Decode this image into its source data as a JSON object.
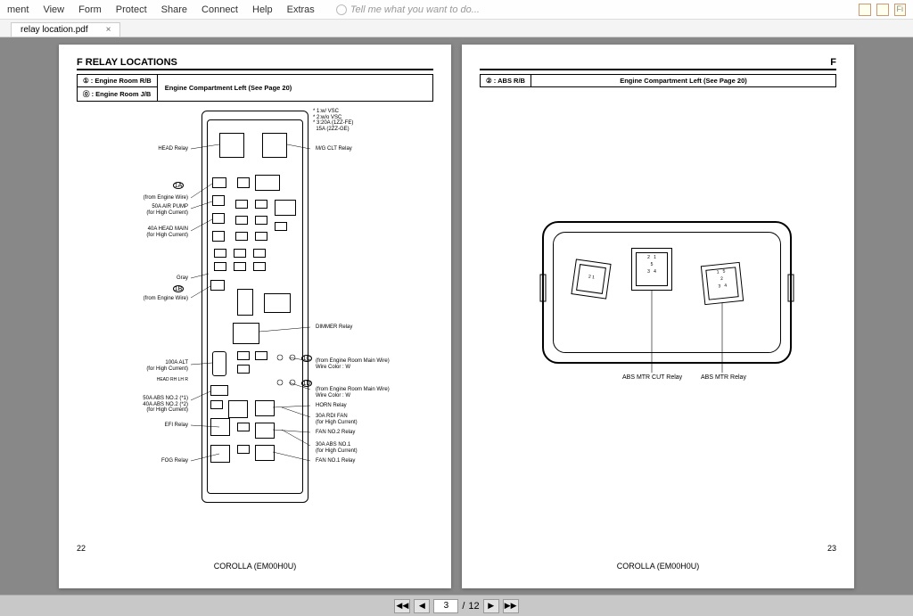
{
  "menu": [
    "ment",
    "View",
    "Form",
    "Protect",
    "Share",
    "Connect",
    "Help",
    "Extras"
  ],
  "tell_me": "Tell me what you want to do...",
  "tab_name": "relay location.pdf",
  "tab_close": "×",
  "pager": {
    "first": "◀◀",
    "prev": "◀",
    "next": "▶",
    "last": "▶▶",
    "page": "3",
    "sep": "/",
    "total": "12"
  },
  "right_btn_text": "Fi",
  "left_page": {
    "section": "F  RELAY LOCATIONS",
    "legend": {
      "row1": "①  : Engine Room R/B",
      "row2": "⓪  : Engine Room J/B",
      "col2": "Engine Compartment Left (See Page 20)"
    },
    "notes": "* 1:w/ VSC\n* 2:w/o VSC\n* 3:20A (1ZZ-FE)\n  15A (2ZZ-GE)",
    "labels_left": [
      "HEAD Relay",
      "(from Engine Wire)",
      "50A AIR PUMP\n(for High Current)",
      "40A HEAD MAIN\n(for High Current)",
      "Gray",
      "(from Engine Wire)",
      "100A ALT\n(for High Current)",
      "50A ABS NO.2 (*1)\n40A ABS NO.2 (*2)\n(for High Current)",
      "EFI Relay",
      "FOG Relay"
    ],
    "labels_right": [
      "M/G CLT Relay",
      "DIMMER Relay",
      "(from Engine Room Main Wire)\nWire Color : W",
      "(from Engine Room Main Wire)\nWire Color : W",
      "HORN Relay",
      "30A RDI FAN\n(for High Current)",
      "FAN NO.2 Relay",
      "30A ABS NO.1\n(for High Current)",
      "FAN NO.1 Relay"
    ],
    "markers": {
      "a1": "1A",
      "b1": "1B",
      "c1": "1C",
      "d1": "1D"
    },
    "head_rh_lh": "HEAD RH   LH  R",
    "page_num": "22",
    "model": "COROLLA (EM00H0U)"
  },
  "right_page": {
    "section": "F",
    "legend": {
      "row1": "②  : ABS R/B",
      "col2": "Engine Compartment Left (See Page 20)"
    },
    "labels": [
      "ABS MTR CUT Relay",
      "ABS MTR Relay"
    ],
    "relay_nums": {
      "r1": "2   1",
      "r2": "2   1\n5\n3   4",
      "r3": "1   5\n2\n3   4"
    },
    "page_num": "23",
    "model": "COROLLA (EM00H0U)"
  }
}
